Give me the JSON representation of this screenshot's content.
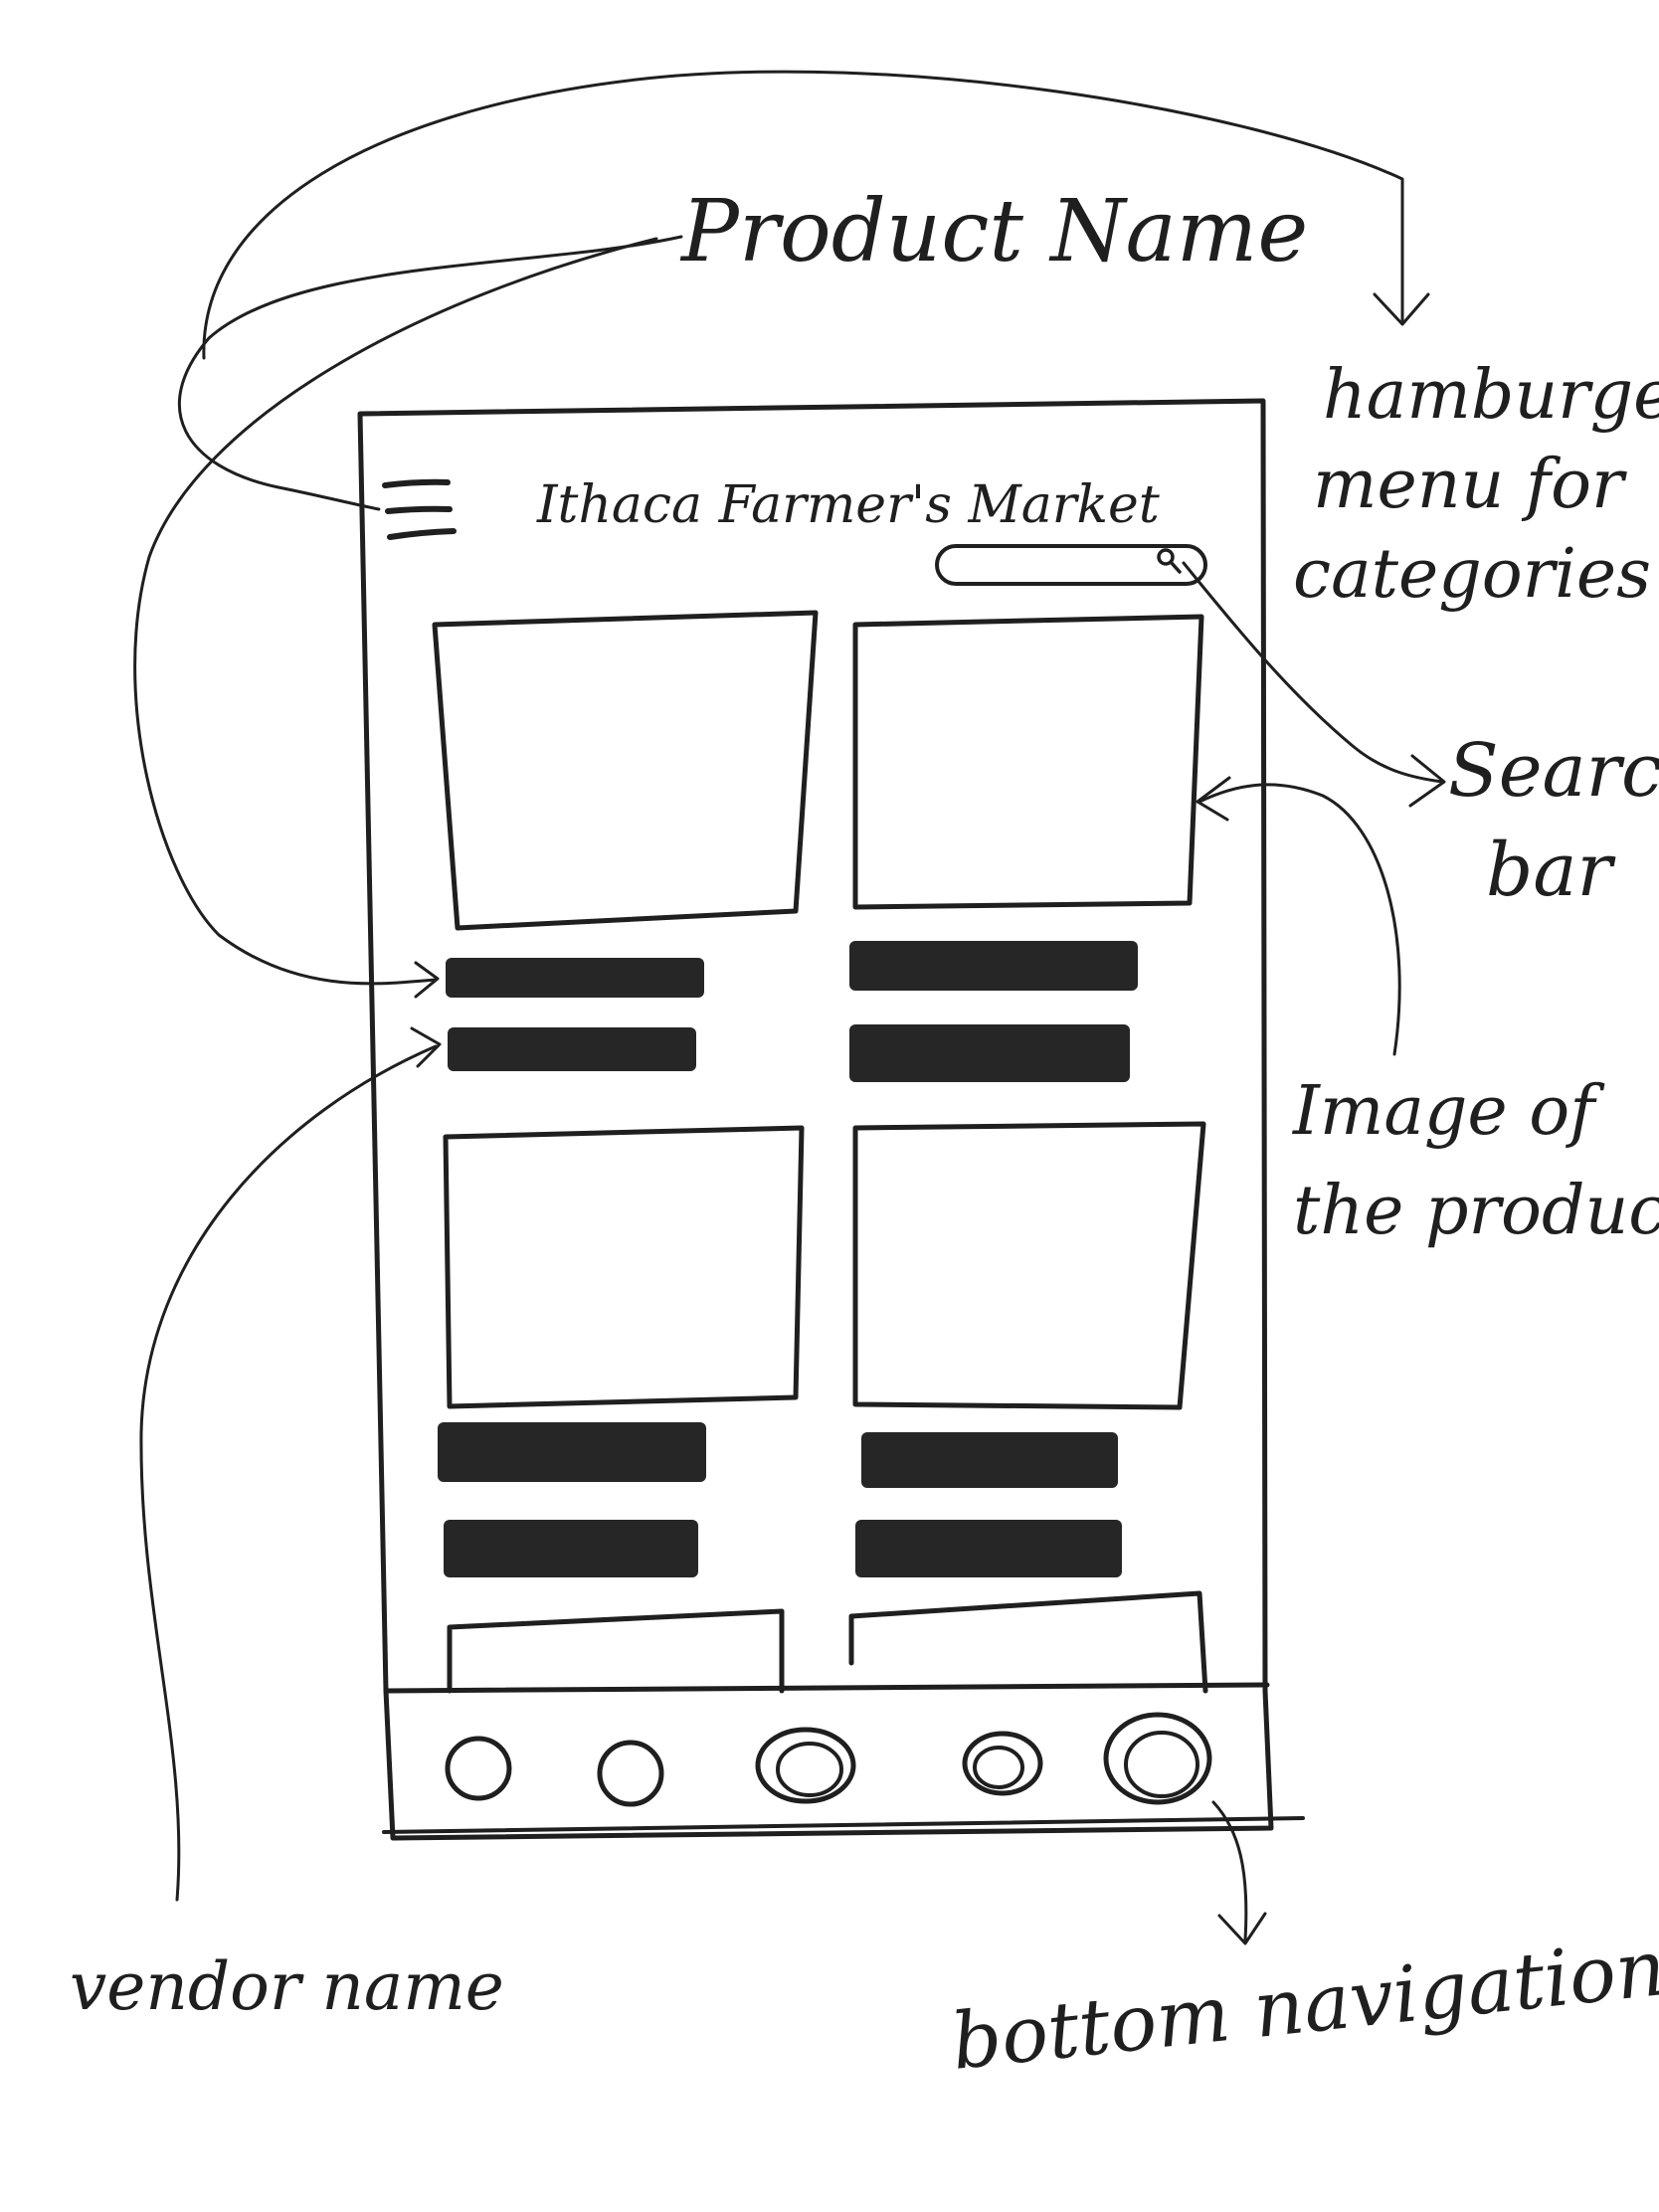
{
  "app": {
    "title": "Ithaca Farmer's Market"
  },
  "annotations": {
    "product_name": "Product Name",
    "hamburger_menu": [
      "hamburger",
      "menu for",
      "categories"
    ],
    "search_bar": [
      "Search",
      "bar"
    ],
    "product_image": [
      "Image of",
      "the product"
    ],
    "vendor_name": "vendor name",
    "bottom_navigation": "bottom navigation"
  },
  "grid": {
    "columns": 2,
    "visible_cards": 6
  },
  "bottom_nav": {
    "item_count": 5
  },
  "colors": {
    "ink": "#1f1f1f",
    "bar_fill": "#262626",
    "paper": "#ffffff"
  }
}
